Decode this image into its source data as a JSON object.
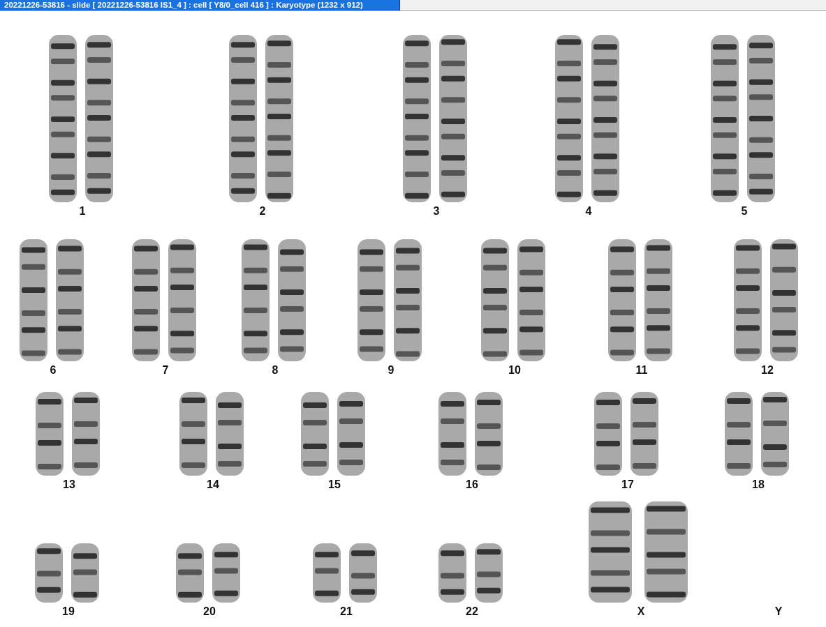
{
  "window": {
    "title": "20221226-53816 - slide [ 20221226-53816 IS1_4 ] : cell [ Y8/0_cell 416 ] : Karyotype  (1232 x 912)"
  },
  "karyotype": {
    "rows": [
      [
        {
          "label": "1",
          "kind": "pair"
        },
        {
          "label": "2",
          "kind": "pair"
        },
        {
          "label": "3",
          "kind": "pair"
        },
        {
          "label": "4",
          "kind": "pair"
        },
        {
          "label": "5",
          "kind": "pair"
        }
      ],
      [
        {
          "label": "6",
          "kind": "pair"
        },
        {
          "label": "7",
          "kind": "pair"
        },
        {
          "label": "8",
          "kind": "pair"
        },
        {
          "label": "9",
          "kind": "pair"
        },
        {
          "label": "10",
          "kind": "pair"
        },
        {
          "label": "11",
          "kind": "pair"
        },
        {
          "label": "12",
          "kind": "pair"
        }
      ],
      [
        {
          "label": "13",
          "kind": "pair"
        },
        {
          "label": "14",
          "kind": "pair"
        },
        {
          "label": "15",
          "kind": "pair"
        },
        {
          "label": "16",
          "kind": "pair"
        },
        {
          "label": "17",
          "kind": "pair"
        },
        {
          "label": "18",
          "kind": "pair"
        }
      ],
      [
        {
          "label": "19",
          "kind": "pair"
        },
        {
          "label": "20",
          "kind": "pair"
        },
        {
          "label": "21",
          "kind": "pair"
        },
        {
          "label": "22",
          "kind": "pair"
        },
        {
          "label": "X",
          "kind": "large-pair"
        },
        {
          "label": "Y",
          "kind": "empty"
        }
      ]
    ]
  }
}
